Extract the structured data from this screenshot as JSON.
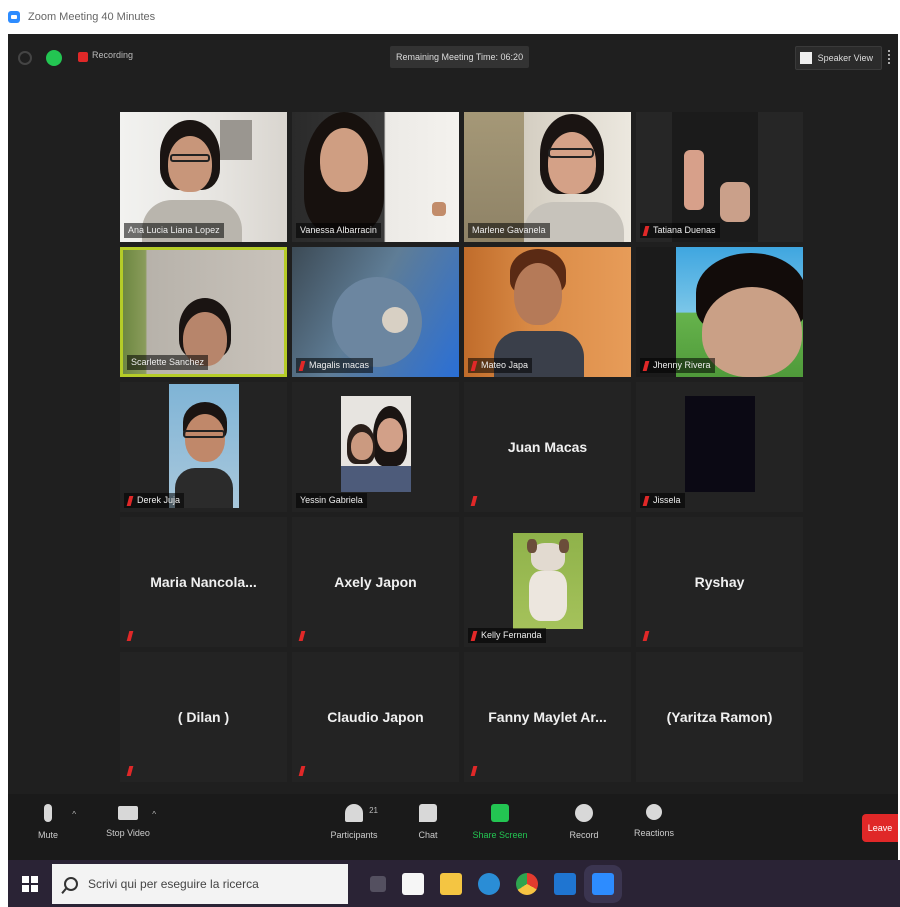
{
  "window": {
    "title": "Zoom Meeting 40 Minutes"
  },
  "topbar": {
    "recording_label": "Recording",
    "meeting_time": "Remaining Meeting Time: 06:20",
    "speaker_view_label": "Speaker View"
  },
  "participants": [
    {
      "name": "Ana Lucia Liana Lopez",
      "video": true
    },
    {
      "name": "Vanessa Albarracin",
      "video": true
    },
    {
      "name": "Marlene Gavanela",
      "video": true
    },
    {
      "name": "Tatiana Duenas",
      "video": true,
      "muted": true
    },
    {
      "name": "Scarlette Sanchez",
      "video": true,
      "active": true
    },
    {
      "name": "Magalis macas",
      "video": true,
      "muted": true
    },
    {
      "name": "Mateo Japa",
      "video": true,
      "muted": true
    },
    {
      "name": "Jhenny Rivera",
      "video": true,
      "muted": true
    },
    {
      "name": "Derek Juja",
      "video": true,
      "muted": true
    },
    {
      "name": "Yessin Gabriela",
      "video": true
    },
    {
      "name": "Juan Macas",
      "video": false,
      "muted": true
    },
    {
      "name": "Jissela",
      "video": true,
      "muted": true
    },
    {
      "name": "Maria Nancola...",
      "video": false,
      "muted": true
    },
    {
      "name": "Axely Japon",
      "video": false,
      "muted": true
    },
    {
      "name": "Kelly Fernanda",
      "video": true,
      "muted": true
    },
    {
      "name": "Ryshay",
      "video": false,
      "muted": true
    },
    {
      "name": "( Dilan )",
      "video": false,
      "muted": true
    },
    {
      "name": "Claudio Japon",
      "video": false,
      "muted": true
    },
    {
      "name": "Fanny Maylet Ar...",
      "video": false,
      "muted": true
    },
    {
      "name": "(Yaritza Ramon)",
      "video": false
    }
  ],
  "toolbar": {
    "mute": "Mute",
    "stop_video": "Stop Video",
    "participants": "Participants",
    "participants_count": "21",
    "chat": "Chat",
    "share_screen": "Share Screen",
    "record": "Record",
    "reactions": "Reactions",
    "leave": "Leave"
  },
  "taskbar": {
    "search_placeholder": "Scrivi qui per eseguire la ricerca"
  },
  "colors": {
    "meeting_bg": "#1f1f1f",
    "tile_bg": "#232323",
    "active_border": "#b5cc28",
    "share_green": "#23c552",
    "leave_red": "#e02828",
    "taskbar": "#2a2335"
  }
}
